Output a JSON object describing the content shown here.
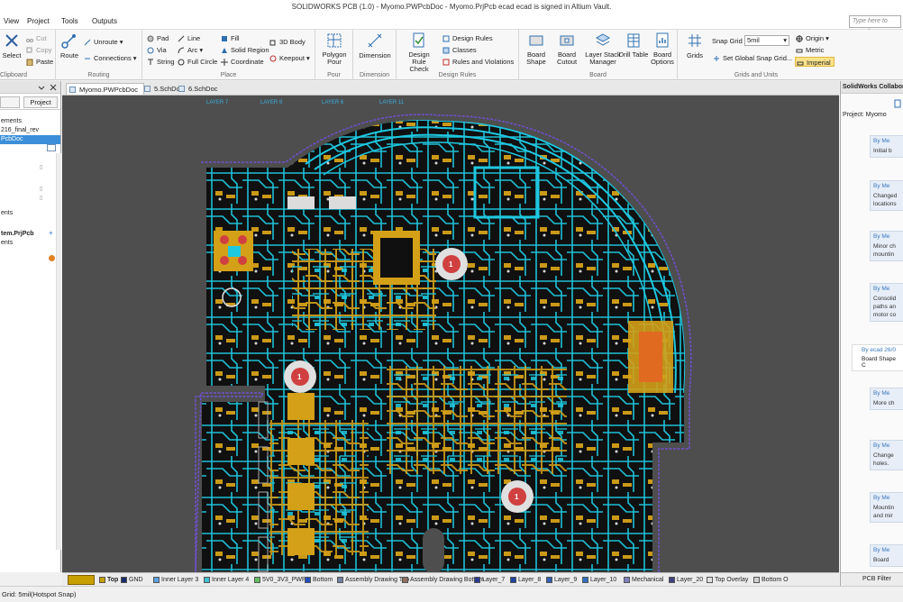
{
  "window": {
    "title": "SOLIDWORKS PCB (1.0) - Myomo.PWPcbDoc - Myomo.PrjPcb ecad ecad is signed in Altium Vault."
  },
  "menu": {
    "items": [
      "View",
      "Project",
      "Tools",
      "Outputs"
    ],
    "search_placeholder": "Type here to search"
  },
  "ribbon": {
    "clipboard": {
      "label": "Clipboard",
      "select": "Select",
      "cut": "Cut",
      "copy": "Copy",
      "paste": "Paste"
    },
    "routing": {
      "label": "Routing",
      "route": "Route",
      "unroute": "Unroute",
      "connections": "Connections"
    },
    "place": {
      "label": "Place",
      "pad": "Pad",
      "via": "Via",
      "string": "String",
      "line": "Line",
      "arc": "Arc",
      "full_circle": "Full Circle",
      "fill": "Fill",
      "solid_region": "Solid Region",
      "coordinate": "Coordinate",
      "body_3d": "3D Body",
      "keepout": "Keepout"
    },
    "pour": {
      "label": "Pour",
      "polygon_pour": "Polygon Pour"
    },
    "dimension": {
      "label": "Dimension",
      "dimension": "Dimension"
    },
    "design_rules": {
      "label": "Design Rules",
      "check": "Design Rule Check",
      "rules": "Design Rules",
      "classes": "Classes",
      "violations": "Rules and Violations"
    },
    "board": {
      "label": "Board",
      "shape": "Board Shape",
      "cutout": "Board Cutout",
      "layer_stack": "Layer Stack Manager",
      "drill_table": "Drill Table",
      "options": "Board Options"
    },
    "grids_units": {
      "label": "Grids and Units",
      "grids": "Grids",
      "snap_grid_label": "Snap Grid",
      "snap_grid_value": "5mil",
      "set_global": "Set Global Snap Grid...",
      "origin": "Origin",
      "metric": "Metric",
      "imperial": "Imperial"
    }
  },
  "left_panel": {
    "tab_project": "Project",
    "tree": [
      "ements",
      "216_final_rev",
      "PcbDoc",
      "",
      "",
      "",
      "",
      "",
      "",
      "",
      "ents",
      "",
      "tem.PrjPcb",
      "ents"
    ]
  },
  "doc_tabs": [
    "Myomo.PWPcbDoc",
    "5.SchDoc",
    "6.SchDoc"
  ],
  "canvas": {
    "layer_labels": [
      "LAYER 7",
      "LAYER 8",
      "LAYER 6",
      "LAYER 11"
    ],
    "mount_label": "1"
  },
  "right_panel": {
    "title": "SolidWorks Collaboration",
    "project": "Project: Myomo",
    "comments": [
      {
        "by": "By Me",
        "text": "Initial b"
      },
      {
        "by": "By Me",
        "text": "Changed locations"
      },
      {
        "by": "By Me",
        "text": "Minor ch mountin"
      },
      {
        "by": "By Me",
        "text": "Consolid paths an motor co"
      },
      {
        "by": "By ecad  26/0",
        "text": "Board Shape C"
      },
      {
        "by": "By Me",
        "text": "More ch"
      },
      {
        "by": "By Me",
        "text": "Change holes."
      },
      {
        "by": "By Me",
        "text": "Mountin and mir"
      },
      {
        "by": "By Me",
        "text": "Board"
      }
    ]
  },
  "layers": [
    {
      "name": "Top",
      "color": "#c8a000"
    },
    {
      "name": "GND",
      "color": "#1a2a6a"
    },
    {
      "name": "Inner Layer 3",
      "color": "#5aa0e0"
    },
    {
      "name": "Inner Layer 4",
      "color": "#40c0d0"
    },
    {
      "name": "5V0_3V3_PWR",
      "color": "#60c060"
    },
    {
      "name": "Bottom",
      "color": "#2050c0"
    },
    {
      "name": "Assembly Drawing Top",
      "color": "#7080a0"
    },
    {
      "name": "Assembly Drawing Bottom",
      "color": "#907060"
    },
    {
      "name": "Layer_7",
      "color": "#2a3a90"
    },
    {
      "name": "Layer_8",
      "color": "#2040a0"
    },
    {
      "name": "Layer_9",
      "color": "#3060b0"
    },
    {
      "name": "Layer_10",
      "color": "#3070c0"
    },
    {
      "name": "Mechanical",
      "color": "#8080c0"
    },
    {
      "name": "Layer_20",
      "color": "#404080"
    },
    {
      "name": "Top Overlay",
      "color": "#e0e0e0"
    },
    {
      "name": "Bottom O",
      "color": "#d0d0d0"
    }
  ],
  "right_bottom_tab": "PCB Filter",
  "status": {
    "coords": "Grid: 5mil",
    "snap": "(Hotspot Snap)"
  },
  "colors": {
    "copper_top": "#d4a017",
    "copper_inner": "#1ec8e0",
    "board": "#101010",
    "background": "#4e4e4e",
    "outline": "#7050d0"
  }
}
